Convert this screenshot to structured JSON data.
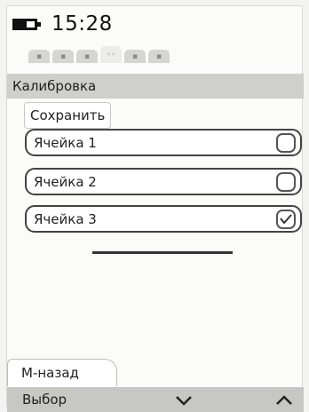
{
  "status": {
    "time": "15:28",
    "battery_level": 0.6
  },
  "tabs": [
    {
      "icon": "tab-icon-1",
      "active": false
    },
    {
      "icon": "tab-icon-2",
      "active": false
    },
    {
      "icon": "tab-icon-3",
      "active": false
    },
    {
      "icon": "tab-icon-4",
      "active": true
    },
    {
      "icon": "tab-icon-5",
      "active": false
    },
    {
      "icon": "tab-icon-6",
      "active": false
    }
  ],
  "screen": {
    "title": "Калибровка"
  },
  "save_label": "Сохранить",
  "cells": [
    {
      "label": "Ячейка 1",
      "checked": false
    },
    {
      "label": "Ячейка 2",
      "checked": false
    },
    {
      "label": "Ячейка 3",
      "checked": true
    }
  ],
  "back_label": "М-назад",
  "softkeys": {
    "left_label": "Выбор",
    "center_icon": "chevron-down-icon",
    "right_icon": "chevron-up-icon"
  }
}
